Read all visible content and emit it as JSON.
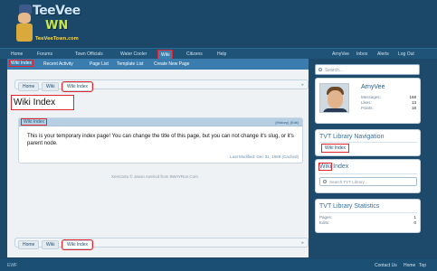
{
  "header": {
    "logo_top": "TeeVee",
    "logo_bottom": "WN",
    "logo_url": "TeeVeeTown.com"
  },
  "nav": {
    "items": [
      "Home",
      "Forums",
      "Town Officials",
      "Water Cooler",
      "Wiki",
      "Citizens",
      "Help"
    ],
    "active": "Wiki",
    "right": [
      "ArnyVee",
      "Inbox",
      "Alerts",
      "Log Out"
    ]
  },
  "subnav": {
    "items": [
      "Wiki Index",
      "Recent Activity",
      "Page List",
      "Template List",
      "Create New Page"
    ]
  },
  "search": {
    "placeholder": "Search..."
  },
  "breadcrumbs": [
    "Home",
    "Wiki",
    "Wiki Index"
  ],
  "page": {
    "title": "Wiki Index",
    "panel_title": "Wiki Index",
    "panel_links": "(History) (Edit)",
    "body": "This is your temporary index page! You can change the title of this page, but you can not change it's slug, or it's parent node.",
    "modified": "Last Modified: Dec 31, 1969 (Cached)",
    "copyright": "XenCarta © Jason Axelrod from 8WAYRun.Com"
  },
  "user": {
    "name": "ArnyVee",
    "stats": [
      {
        "label": "Messages:",
        "value": "168"
      },
      {
        "label": "Likes:",
        "value": "13"
      },
      {
        "label": "Points:",
        "value": "18"
      }
    ]
  },
  "library_nav": {
    "title": "TVT Library Navigation",
    "link": "Wiki Index"
  },
  "wiki_index_block": {
    "title_a": "Wiki",
    "title_b": " Index",
    "placeholder": "Search TVT Library..."
  },
  "library_stats": {
    "title": "TVT Library Statistics",
    "rows": [
      {
        "label": "Pages:",
        "value": "1"
      },
      {
        "label": "Edits:",
        "value": "0"
      }
    ]
  },
  "footer": {
    "left": "EWF",
    "links": [
      "Contact Us",
      "Home",
      "Top"
    ]
  }
}
